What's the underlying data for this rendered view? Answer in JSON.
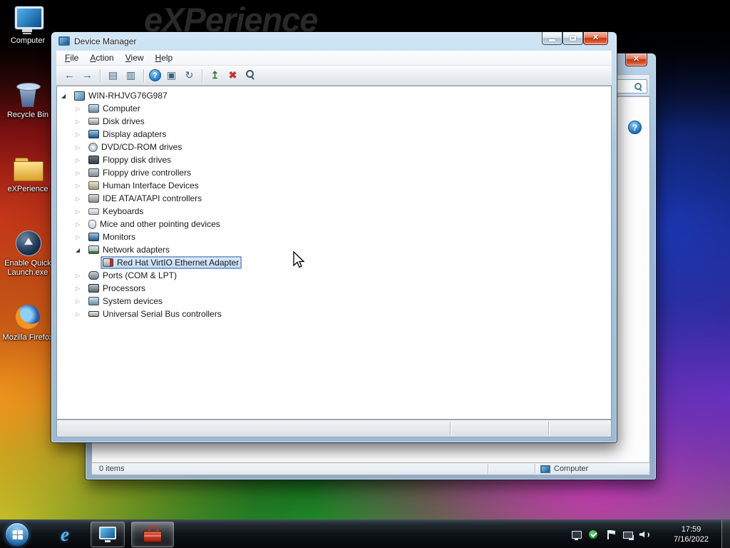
{
  "wallpaper": {
    "watermark": "eXPerience"
  },
  "desktop_icons": [
    {
      "name": "computer",
      "label": "Computer"
    },
    {
      "name": "recycle-bin",
      "label": "Recycle Bin"
    },
    {
      "name": "experience-folder",
      "label": "eXPerience"
    },
    {
      "name": "quick-launch",
      "label": "Enable Quick Launch.exe"
    },
    {
      "name": "firefox",
      "label": "Mozilla Firefox"
    }
  ],
  "device_manager": {
    "title": "Device Manager",
    "menu": [
      "File",
      "Action",
      "View",
      "Help"
    ],
    "toolbar": [
      "back",
      "forward",
      "|",
      "console-tree",
      "properties",
      "|",
      "help",
      "computer",
      "refresh",
      "|",
      "update-driver",
      "uninstall",
      "scan"
    ],
    "tree": [
      {
        "label": "WIN-RHJVG76G987",
        "icon": "computer",
        "level": 0,
        "expander": "expanded",
        "selected": false
      },
      {
        "label": "Computer",
        "icon": "system-device",
        "level": 1,
        "expander": "collapsed",
        "selected": false
      },
      {
        "label": "Disk drives",
        "icon": "disk-drive",
        "level": 1,
        "expander": "collapsed",
        "selected": false
      },
      {
        "label": "Display adapters",
        "icon": "display-adapter",
        "level": 1,
        "expander": "collapsed",
        "selected": false
      },
      {
        "label": "DVD/CD-ROM drives",
        "icon": "dvd-drive",
        "level": 1,
        "expander": "collapsed",
        "selected": false
      },
      {
        "label": "Floppy disk drives",
        "icon": "floppy-drive",
        "level": 1,
        "expander": "collapsed",
        "selected": false
      },
      {
        "label": "Floppy drive controllers",
        "icon": "floppy-controller",
        "level": 1,
        "expander": "collapsed",
        "selected": false
      },
      {
        "label": "Human Interface Devices",
        "icon": "hid",
        "level": 1,
        "expander": "collapsed",
        "selected": false
      },
      {
        "label": "IDE ATA/ATAPI controllers",
        "icon": "ide-controller",
        "level": 1,
        "expander": "collapsed",
        "selected": false
      },
      {
        "label": "Keyboards",
        "icon": "keyboard",
        "level": 1,
        "expander": "collapsed",
        "selected": false
      },
      {
        "label": "Mice and other pointing devices",
        "icon": "mouse",
        "level": 1,
        "expander": "collapsed",
        "selected": false
      },
      {
        "label": "Monitors",
        "icon": "monitor",
        "level": 1,
        "expander": "collapsed",
        "selected": false
      },
      {
        "label": "Network adapters",
        "icon": "network-adapter-cat",
        "level": 1,
        "expander": "expanded",
        "selected": false
      },
      {
        "label": "Red Hat VirtIO Ethernet Adapter",
        "icon": "network-adapter",
        "level": 2,
        "expander": "none",
        "selected": true
      },
      {
        "label": "Ports (COM & LPT)",
        "icon": "ports",
        "level": 1,
        "expander": "collapsed",
        "selected": false
      },
      {
        "label": "Processors",
        "icon": "processor",
        "level": 1,
        "expander": "collapsed",
        "selected": false
      },
      {
        "label": "System devices",
        "icon": "system-device",
        "level": 1,
        "expander": "collapsed",
        "selected": false
      },
      {
        "label": "Universal Serial Bus controllers",
        "icon": "usb-controller",
        "level": 1,
        "expander": "collapsed",
        "selected": false
      }
    ]
  },
  "explorer": {
    "status_items": "0 items",
    "status_location": "Computer"
  },
  "taskbar": {
    "tray": [
      "device",
      "security",
      "flag",
      "network",
      "volume"
    ],
    "clock": {
      "time": "17:59",
      "date": "7/16/2022"
    }
  }
}
